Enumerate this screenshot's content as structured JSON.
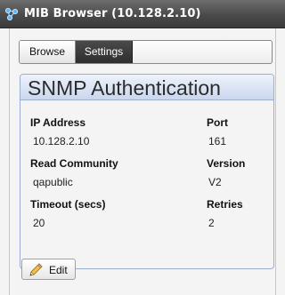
{
  "window": {
    "title": "MIB Browser (10.128.2.10)",
    "icon": "network-nodes-icon"
  },
  "tabs": [
    {
      "label": "Browse",
      "active": false
    },
    {
      "label": "Settings",
      "active": true
    }
  ],
  "panel": {
    "title": "SNMP Authentication",
    "fields": {
      "ip_address": {
        "label": "IP Address",
        "value": "10.128.2.10"
      },
      "port": {
        "label": "Port",
        "value": "161"
      },
      "read_community": {
        "label": "Read Community",
        "value": "qapublic"
      },
      "version": {
        "label": "Version",
        "value": "V2"
      },
      "timeout": {
        "label": "Timeout (secs)",
        "value": "20"
      },
      "retries": {
        "label": "Retries",
        "value": "2"
      }
    }
  },
  "actions": {
    "edit_label": "Edit",
    "edit_icon": "pencil-icon"
  },
  "colors": {
    "titlebar": "#4a4a4a",
    "active_tab": "#333333",
    "panel_border": "#9aaed0",
    "panel_header": "#c9d7ee"
  }
}
